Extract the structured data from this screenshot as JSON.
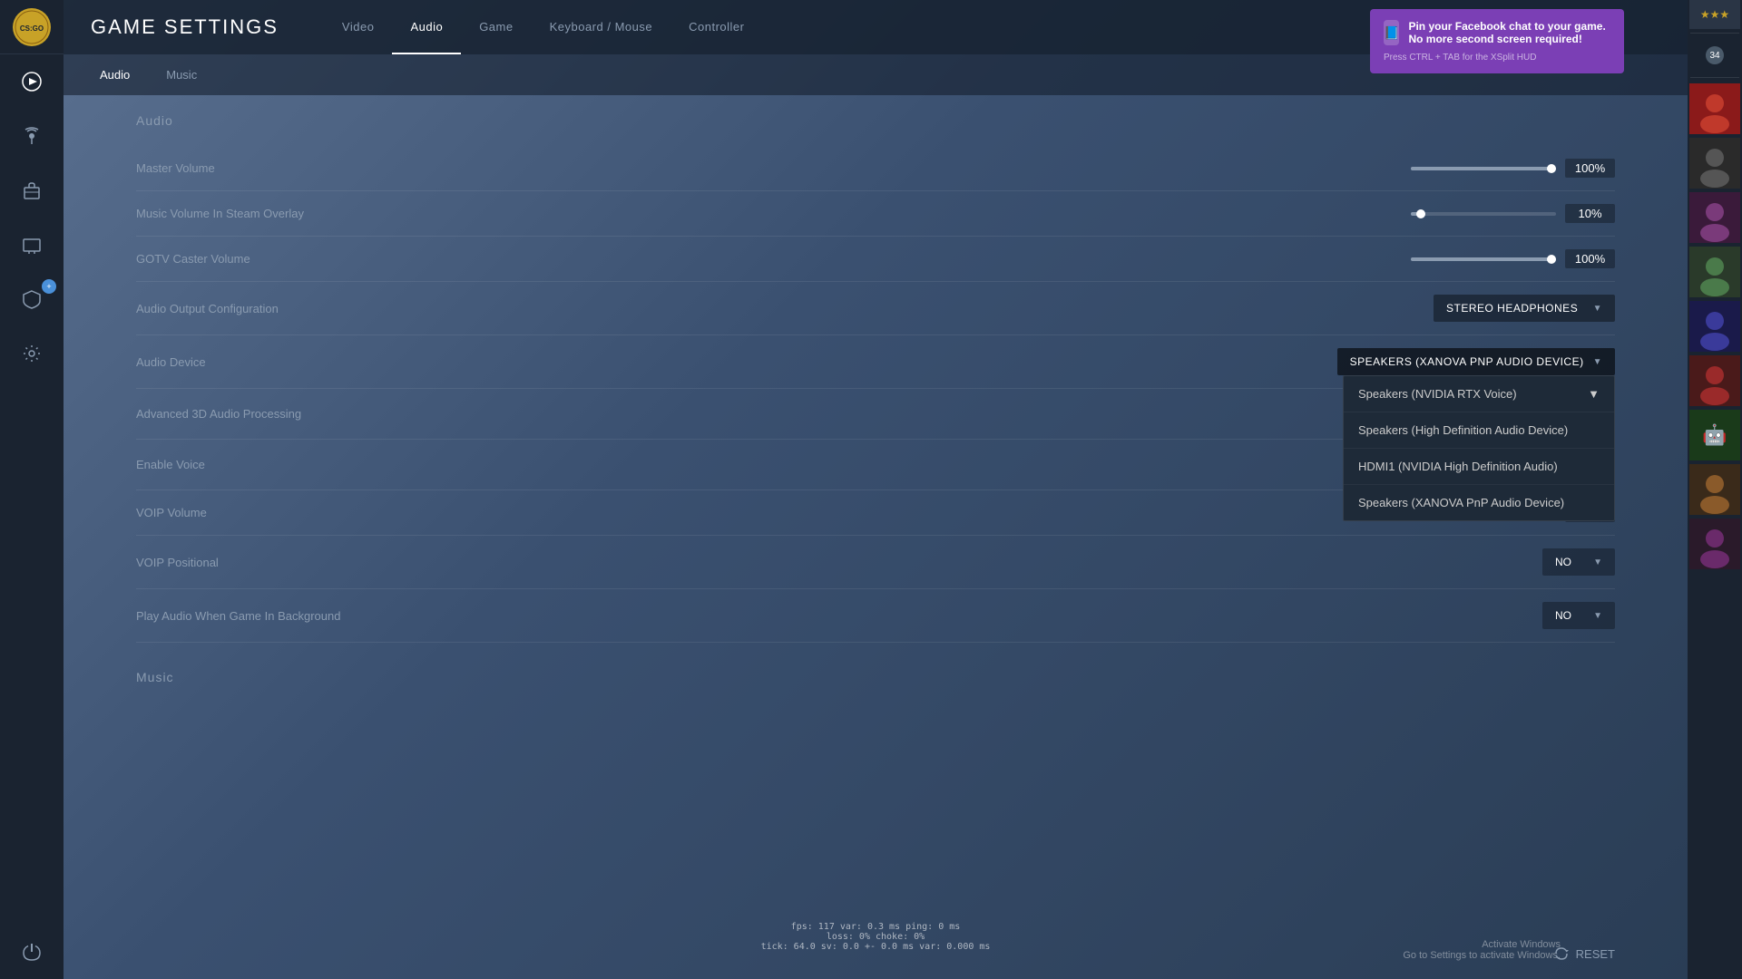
{
  "app": {
    "title": "GAME SETTINGS",
    "logo_text": "CS:GO"
  },
  "sidebar": {
    "icons": [
      {
        "name": "play-icon",
        "symbol": "▶",
        "active": true
      },
      {
        "name": "radio-icon",
        "symbol": "📡",
        "active": false
      },
      {
        "name": "briefcase-icon",
        "symbol": "🎒",
        "active": false
      },
      {
        "name": "tv-icon",
        "symbol": "📺",
        "active": false
      },
      {
        "name": "shield-badge-icon",
        "symbol": "🛡",
        "active": false,
        "badge": "+"
      },
      {
        "name": "gear-icon",
        "symbol": "⚙",
        "active": false
      },
      {
        "name": "power-icon",
        "symbol": "⏻",
        "active": false
      }
    ]
  },
  "nav_tabs": [
    {
      "label": "Video",
      "active": false
    },
    {
      "label": "Audio",
      "active": true
    },
    {
      "label": "Game",
      "active": false
    },
    {
      "label": "Keyboard / Mouse",
      "active": false
    },
    {
      "label": "Controller",
      "active": false
    }
  ],
  "sub_tabs": [
    {
      "label": "Audio",
      "active": true
    },
    {
      "label": "Music",
      "active": false
    }
  ],
  "audio_section": {
    "title": "Audio",
    "settings": [
      {
        "label": "Master Volume",
        "type": "slider",
        "fill_percent": 100,
        "value": "100%"
      },
      {
        "label": "Music Volume In Steam Overlay",
        "type": "slider",
        "fill_percent": 10,
        "value": "10%"
      },
      {
        "label": "GOTV Caster Volume",
        "type": "slider",
        "fill_percent": 100,
        "value": "100%"
      },
      {
        "label": "Audio Output Configuration",
        "type": "dropdown",
        "value": "STEREO HEADPHONES",
        "open": false
      },
      {
        "label": "Audio Device",
        "type": "dropdown",
        "value": "SPEAKERS (XANOVA PNP AUDIO DEVICE)",
        "open": true,
        "options": [
          {
            "label": "Speakers (NVIDIA RTX Voice)",
            "has_chevron": true
          },
          {
            "label": "Speakers (High Definition Audio Device)",
            "has_chevron": false
          },
          {
            "label": "HDMI1 (NVIDIA High Definition Audio)",
            "has_chevron": false
          },
          {
            "label": "Speakers (XANOVA PnP Audio Device)",
            "has_chevron": false
          }
        ]
      },
      {
        "label": "Advanced 3D Audio Processing",
        "type": "dropdown_no",
        "value": ""
      },
      {
        "label": "Enable Voice",
        "type": "dropdown_no",
        "value": ""
      },
      {
        "label": "VOIP Volume",
        "type": "slider_small",
        "fill_percent": 80,
        "value": "%"
      },
      {
        "label": "VOIP Positional",
        "type": "dropdown_no_text",
        "value": "NO"
      },
      {
        "label": "Play Audio When Game In Background",
        "type": "dropdown_no_text",
        "value": "NO"
      }
    ]
  },
  "music_section": {
    "title": "Music"
  },
  "notification": {
    "title": "Pin your Facebook chat to your game. No more second screen required!",
    "footer": "Press CTRL + TAB for the XSplit HUD"
  },
  "friends": {
    "online_count": "34"
  },
  "debug": {
    "line1": "fps: 117  var: 0.3 ms  ping: 0 ms",
    "line2": "loss:  0%  choke:  0%",
    "line3": "tick: 64.0  sv: 0.0 +-  0.0 ms   var: 0.000 ms"
  },
  "activate_windows": {
    "line1": "Activate Windows",
    "line2": "Go to Settings to activate Windows."
  },
  "reset_button": {
    "label": "RESET"
  }
}
